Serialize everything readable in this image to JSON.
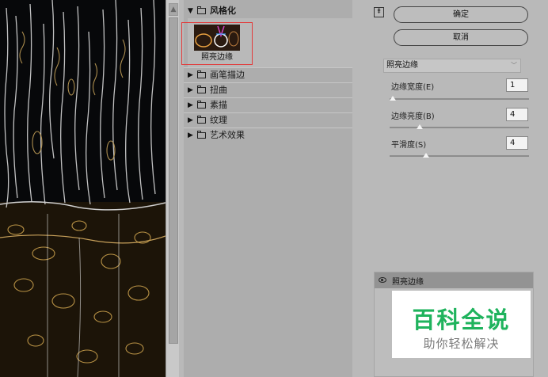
{
  "gallery": {
    "stylize": {
      "label": "风格化",
      "expanded": true
    },
    "selected_filter_label": "照亮边缘",
    "categories": [
      {
        "label": "画笔描边"
      },
      {
        "label": "扭曲"
      },
      {
        "label": "素描"
      },
      {
        "label": "纹理"
      },
      {
        "label": "艺术效果"
      }
    ]
  },
  "settings": {
    "ok_label": "确定",
    "cancel_label": "取消",
    "filter_select_value": "照亮边缘",
    "params": [
      {
        "label": "边缘宽度(E)",
        "value": "1",
        "slider_fraction": 0.0
      },
      {
        "label": "边缘亮度(B)",
        "value": "4",
        "slider_fraction": 0.2
      },
      {
        "label": "平滑度(S)",
        "value": "4",
        "slider_fraction": 0.25
      }
    ]
  },
  "layers": {
    "active_layer_label": "照亮边缘"
  },
  "watermark": {
    "title": "百科全说",
    "subtitle": "助你轻松解决"
  },
  "colors": {
    "watermark_green": "#1fb35d",
    "selection_red": "#e23b3b",
    "preview_bg": "#07080a"
  }
}
